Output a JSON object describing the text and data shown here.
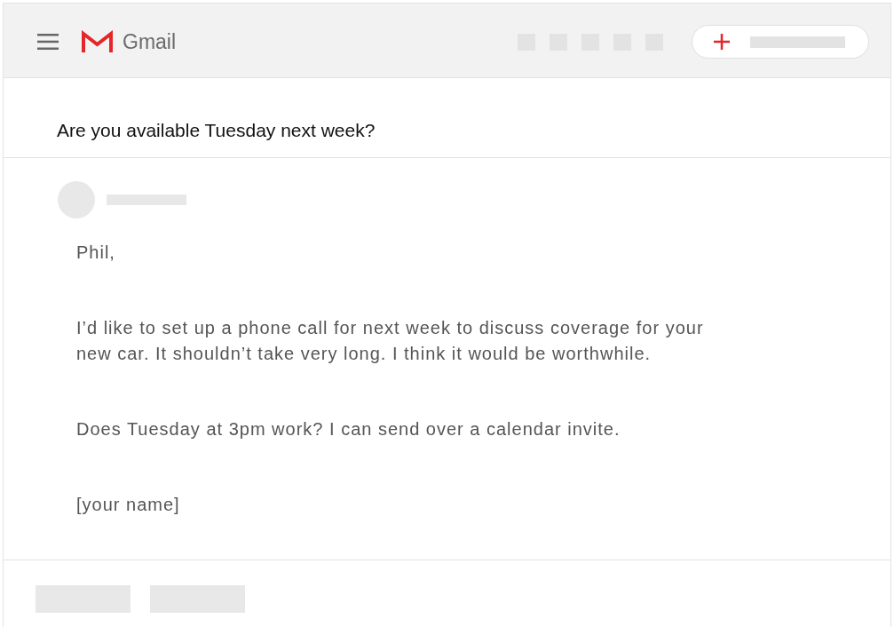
{
  "app": {
    "name": "Gmail"
  },
  "email": {
    "subject": "Are you available Tuesday next week?",
    "paragraphs": [
      [
        "Phil,"
      ],
      [
        "I’d like to set up a phone call for next week to discuss coverage for your",
        "new car. It shouldn’t take very long. I think it would be worthwhile."
      ],
      [
        "Does Tuesday at 3pm work? I can send over a calendar invite."
      ],
      [
        "[your name]"
      ]
    ]
  }
}
